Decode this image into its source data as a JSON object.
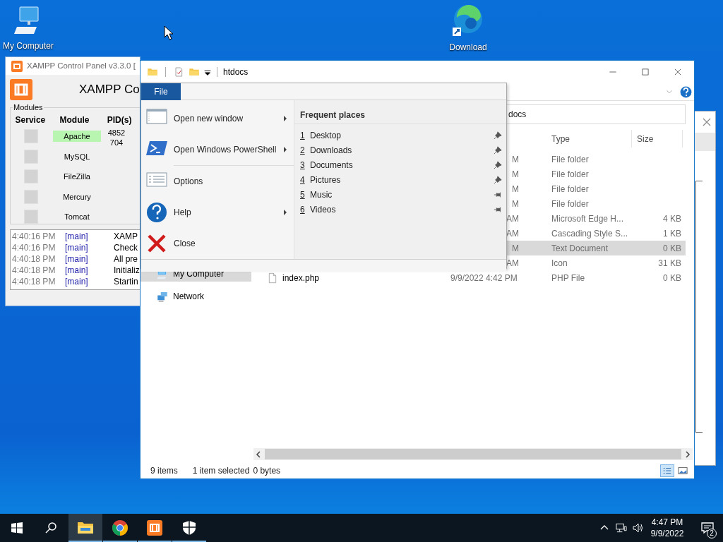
{
  "desktop_icons": [
    {
      "kind": "computer",
      "label": "My Computer"
    },
    {
      "kind": "edge",
      "label": "Download"
    }
  ],
  "xampp": {
    "title": "XAMPP Control Panel v3.3.0 [",
    "header": "XAMPP Co",
    "group_label": "Modules",
    "columns": [
      "Service",
      "Module",
      "PID(s)"
    ],
    "modules": [
      {
        "name": "Apache",
        "running": true,
        "checked": false,
        "pids": [
          "4852",
          "704"
        ]
      },
      {
        "name": "MySQL",
        "running": false,
        "checked": false
      },
      {
        "name": "FileZilla",
        "running": false,
        "checked": false
      },
      {
        "name": "Mercury",
        "running": false,
        "checked": false
      },
      {
        "name": "Tomcat",
        "running": false,
        "checked": false
      }
    ],
    "log": [
      {
        "time": "4:40:16 PM",
        "source": "[main]",
        "message": "XAMP"
      },
      {
        "time": "4:40:16 PM",
        "source": "[main]",
        "message": "Check"
      },
      {
        "time": "4:40:18 PM",
        "source": "[main]",
        "message": "All pre"
      },
      {
        "time": "4:40:18 PM",
        "source": "[main]",
        "message": "Initializ"
      },
      {
        "time": "4:40:18 PM",
        "source": "[main]",
        "message": "Startin"
      }
    ]
  },
  "explorer": {
    "title": "htdocs",
    "address": "docs",
    "columns": [
      "Type",
      "Size"
    ],
    "rows": [
      {
        "date": "M",
        "type": "File folder",
        "selected": false
      },
      {
        "date": "M",
        "type": "File folder",
        "selected": false
      },
      {
        "date": "M",
        "type": "File folder",
        "selected": false
      },
      {
        "date": "M",
        "type": "File folder",
        "selected": false
      },
      {
        "date": "AM",
        "type": "Microsoft Edge H...",
        "size": "4 KB",
        "selected": false
      },
      {
        "date": "AM",
        "type": "Cascading Style S...",
        "size": "1 KB",
        "selected": false
      },
      {
        "date": "M",
        "type": "Text Document",
        "size": "0 KB",
        "selected": true
      },
      {
        "date": "AM",
        "type": "Icon",
        "size": "31 KB",
        "selected": false
      },
      {
        "name": "index.php",
        "date": "9/9/2022 4:42 PM",
        "type": "PHP File",
        "size": "0 KB",
        "selected": false,
        "kind": "file"
      }
    ],
    "nav": [
      {
        "label": "My Computer",
        "kind": "computer",
        "selected": true
      },
      {
        "label": "Network",
        "kind": "network",
        "selected": false
      }
    ],
    "status": [
      "9 items",
      "1 item selected",
      "0 bytes"
    ]
  },
  "file_menu": {
    "tab": "File",
    "command_groups": [
      [
        {
          "kind": "window",
          "label": "Open new window",
          "submenu": true
        },
        {
          "kind": "powershell",
          "label": "Open Windows PowerShell",
          "submenu": true
        }
      ],
      [
        {
          "kind": "options",
          "label": "Options",
          "submenu": false
        },
        {
          "kind": "help",
          "label": "Help",
          "submenu": true
        },
        {
          "kind": "close",
          "label": "Close",
          "submenu": false
        }
      ]
    ],
    "places_title": "Frequent places",
    "places": [
      {
        "number": "1",
        "label": "Desktop",
        "pinned": true
      },
      {
        "number": "2",
        "label": "Downloads",
        "pinned": true
      },
      {
        "number": "3",
        "label": "Documents",
        "pinned": true
      },
      {
        "number": "4",
        "label": "Pictures",
        "pinned": true
      },
      {
        "number": "5",
        "label": "Music",
        "pinned": false
      },
      {
        "number": "6",
        "label": "Videos",
        "pinned": false
      }
    ]
  },
  "taskbar": {
    "apps": [
      {
        "kind": "explorer",
        "running": true,
        "active": true
      },
      {
        "kind": "chrome",
        "running": true,
        "active": false
      },
      {
        "kind": "xampp",
        "running": true,
        "active": false
      },
      {
        "kind": "shield",
        "running": true,
        "active": false
      }
    ],
    "time": "4:47 PM",
    "date": "9/9/2022",
    "notifications": "2"
  }
}
